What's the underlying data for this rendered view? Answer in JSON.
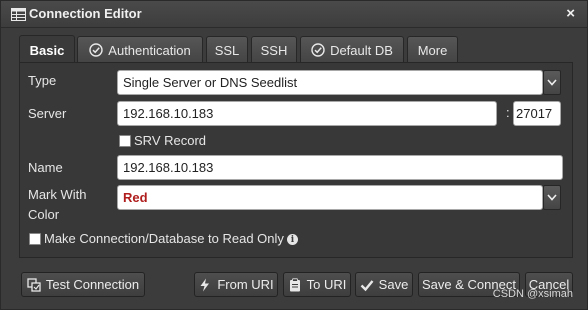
{
  "window": {
    "title": "Connection Editor",
    "close_label": "×"
  },
  "tabs": [
    {
      "label": "Basic",
      "active": true,
      "icon": ""
    },
    {
      "label": "Authentication",
      "active": false,
      "icon": "check-circle-icon"
    },
    {
      "label": "SSL",
      "active": false,
      "icon": ""
    },
    {
      "label": "SSH",
      "active": false,
      "icon": ""
    },
    {
      "label": "Default DB",
      "active": false,
      "icon": "check-circle-icon"
    },
    {
      "label": "More",
      "active": false,
      "icon": ""
    }
  ],
  "form": {
    "type_label": "Type",
    "type_value": "Single Server or DNS Seedlist",
    "server_label": "Server",
    "server_value": "192.168.10.183",
    "port_separator": ":",
    "port_value": "27017",
    "srv_label": "SRV Record",
    "srv_checked": false,
    "name_label": "Name",
    "name_value": "192.168.10.183",
    "mark_label_line1": "Mark With",
    "mark_label_line2": "Color",
    "mark_value": "Red",
    "mark_color": "#b01d1d",
    "readonly_label": "Make Connection/Database to Read Only",
    "readonly_checked": false
  },
  "buttons": {
    "test_connection": "Test Connection",
    "from_uri": "From URI",
    "to_uri": "To URI",
    "save": "Save",
    "save_connect": "Save & Connect",
    "cancel": "Cancel"
  },
  "watermark": "CSDN @xsimah"
}
